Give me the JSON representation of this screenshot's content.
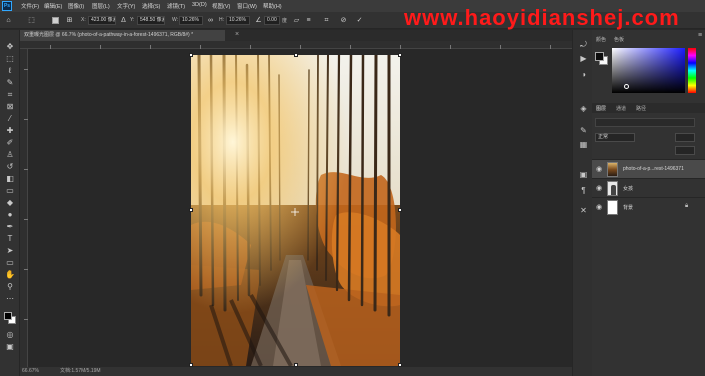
{
  "menubar": {
    "app_logo": "Ps",
    "items": [
      "文件(F)",
      "编辑(E)",
      "图像(I)",
      "图层(L)",
      "文字(Y)",
      "选择(S)",
      "滤镜(T)",
      "3D(D)",
      "视图(V)",
      "窗口(W)",
      "帮助(H)"
    ]
  },
  "options": {
    "x_label": "X:",
    "x_value": "423.00 像素",
    "y_label": "Y:",
    "y_value": "548.50 像素",
    "w_label": "W:",
    "w_value": "10.26%",
    "h_label": "H:",
    "h_value": "10.26%",
    "angle_value": "0.00",
    "angle_unit": "度",
    "cancel_icon": "no-symbol-icon",
    "commit_icon": "check-icon"
  },
  "watermark": "www.haoyidianshej.com",
  "document": {
    "tab_title": "双重曝光图层 @ 66.7% (photo-of-a-pathway-in-a-forest-1496371, RGB/8#) *",
    "zoom": "66.67%",
    "doc_info": "文档:1.57M/5.19M"
  },
  "panels": {
    "color_tabs": [
      "颜色",
      "色板"
    ],
    "layers_tabs": [
      "图层",
      "通道",
      "路径"
    ],
    "blend_mode": "正常",
    "layers": [
      {
        "name": "photo-of-a-p...rest-1496371",
        "selected": true
      },
      {
        "name": "女孩",
        "selected": false
      },
      {
        "name": "背景",
        "selected": false,
        "locked": true
      }
    ]
  }
}
